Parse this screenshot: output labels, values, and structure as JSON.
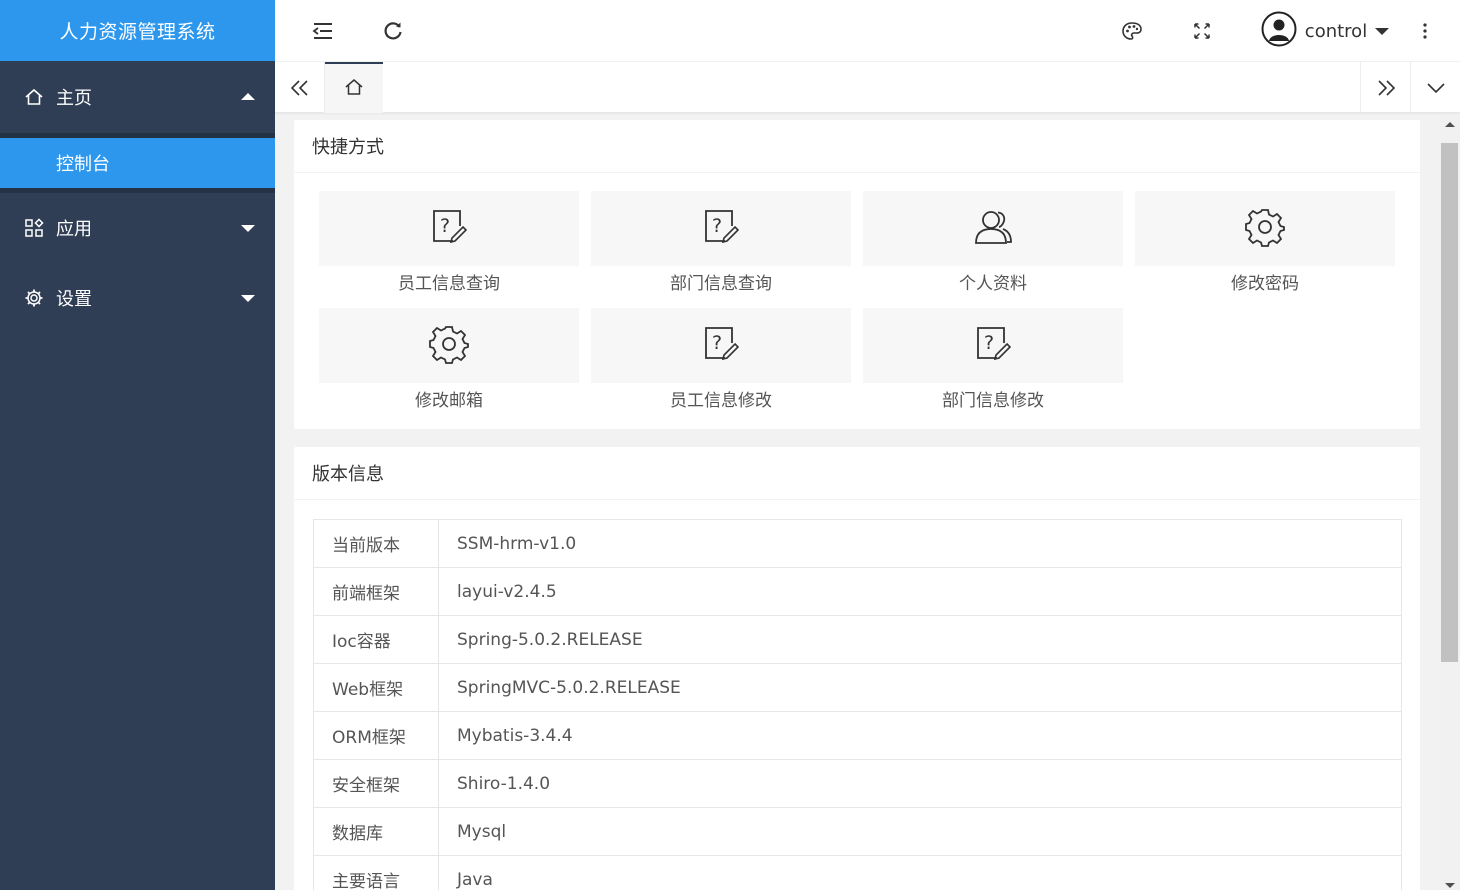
{
  "app": {
    "title": "人力资源管理系统"
  },
  "sidebar": {
    "items": [
      {
        "label": "主页",
        "icon": "home-icon",
        "expanded": true,
        "children": [
          {
            "label": "控制台",
            "active": true
          }
        ]
      },
      {
        "label": "应用",
        "icon": "apps-icon",
        "expanded": false
      },
      {
        "label": "设置",
        "icon": "gear-icon",
        "expanded": false
      }
    ]
  },
  "header": {
    "user": {
      "name": "control"
    },
    "icons": [
      "menu-fold-icon",
      "refresh-icon",
      "palette-icon",
      "fullscreen-icon",
      "avatar",
      "more-vertical-icon"
    ]
  },
  "tabs": {
    "home_icon": "home-icon"
  },
  "shortcuts": {
    "title": "快捷方式",
    "items": [
      {
        "label": "员工信息查询",
        "icon": "help-edit-icon"
      },
      {
        "label": "部门信息查询",
        "icon": "help-edit-icon"
      },
      {
        "label": "个人资料",
        "icon": "users-icon"
      },
      {
        "label": "修改密码",
        "icon": "gear-icon"
      },
      {
        "label": "修改邮箱",
        "icon": "gear-icon"
      },
      {
        "label": "员工信息修改",
        "icon": "help-edit-icon"
      },
      {
        "label": "部门信息修改",
        "icon": "help-edit-icon"
      }
    ]
  },
  "version": {
    "title": "版本信息",
    "rows": [
      {
        "key": "当前版本",
        "value": "SSM-hrm-v1.0"
      },
      {
        "key": "前端框架",
        "value": "layui-v2.4.5"
      },
      {
        "key": "Ioc容器",
        "value": "Spring-5.0.2.RELEASE"
      },
      {
        "key": "Web框架",
        "value": "SpringMVC-5.0.2.RELEASE"
      },
      {
        "key": "ORM框架",
        "value": "Mybatis-3.4.4"
      },
      {
        "key": "安全框架",
        "value": "Shiro-1.4.0"
      },
      {
        "key": "数据库",
        "value": "Mysql"
      },
      {
        "key": "主要语言",
        "value": "Java"
      }
    ]
  },
  "colors": {
    "brand": "#2d97ee",
    "sidebar": "#2f3e54"
  }
}
